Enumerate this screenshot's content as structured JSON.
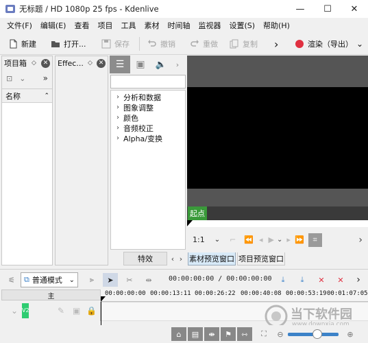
{
  "window": {
    "title": "无标题 / HD 1080p 25 fps - Kdenlive",
    "minimize": "—",
    "maximize": "☐",
    "close": "✕"
  },
  "menu": [
    "文件(F)",
    "编辑(E)",
    "查看",
    "项目",
    "工具",
    "素材",
    "时间轴",
    "监视器",
    "设置(S)",
    "帮助(H)"
  ],
  "toolbar": {
    "new": "新建",
    "open": "打开...",
    "save": "保存",
    "undo": "撤销",
    "redo": "重做",
    "copy": "复制",
    "more": "›",
    "render": "渲染（导出）",
    "dropdown": "⌄"
  },
  "project_bin": {
    "title": "项目箱",
    "column": "名称"
  },
  "effects_panel": {
    "title": "Effec...",
    "categories": [
      "分析和数据",
      "图象调整",
      "颜色",
      "音频校正",
      "Alpha/变换"
    ]
  },
  "tabs_bottom": {
    "effects_tab": "特效",
    "clip_monitor_tab": "素材预览窗口",
    "project_monitor_tab": "项目预览窗口"
  },
  "monitor": {
    "in_point_label": "起点",
    "zoom": "1:1"
  },
  "timeline": {
    "mode": "普通模式",
    "timecode": "00:00:00:00 / 00:00:00:00",
    "master": "主",
    "ruler": [
      "00:00:00:00",
      "00:00:13:11",
      "00:00:26:22",
      "00:00:40:08",
      "00:00:53:19",
      "00:01:07:05"
    ],
    "track_name": "V2"
  },
  "watermark": {
    "main": "当下软件园",
    "sub": "www.downxia.com"
  },
  "colors": {
    "render_dot": "#e03040",
    "in_point_green": "#3a9a3a",
    "track_green": "#2ecc71",
    "selection_blue": "#3c82c8"
  }
}
